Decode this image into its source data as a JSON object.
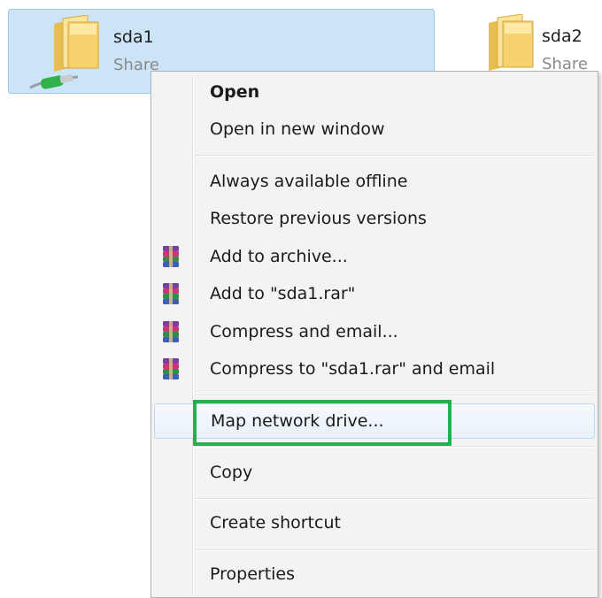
{
  "shares": [
    {
      "name": "sda1",
      "subtitle": "Share",
      "selected": true
    },
    {
      "name": "sda2",
      "subtitle": "Share",
      "selected": false
    }
  ],
  "icons": {
    "folder": "folder-icon",
    "network": "network-cable-icon",
    "archive": "winrar-archive-icon"
  },
  "colors": {
    "selection": "#cce4f7",
    "highlight_box": "#22b14c"
  },
  "context_menu": {
    "items": [
      {
        "label": "Open",
        "bold": true
      },
      {
        "label": "Open in new window"
      },
      {
        "label": "Always available offline"
      },
      {
        "label": "Restore previous versions"
      },
      {
        "label": "Add to archive...",
        "icon": "winrar-archive-icon"
      },
      {
        "label": "Add to \"sda1.rar\"",
        "icon": "winrar-archive-icon"
      },
      {
        "label": "Compress and email...",
        "icon": "winrar-archive-icon"
      },
      {
        "label": "Compress to \"sda1.rar\" and email",
        "icon": "winrar-archive-icon"
      },
      {
        "label": "Map network drive...",
        "highlighted": true
      },
      {
        "label": "Copy"
      },
      {
        "label": "Create shortcut"
      },
      {
        "label": "Properties"
      }
    ]
  }
}
